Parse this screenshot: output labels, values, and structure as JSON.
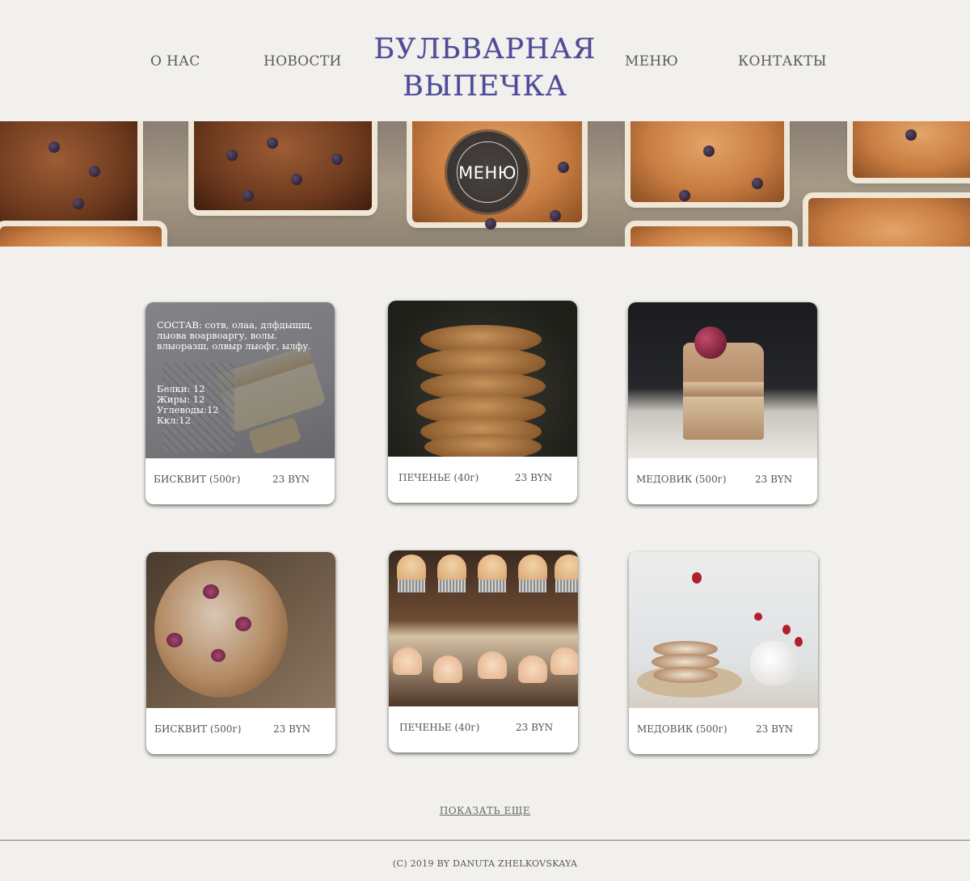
{
  "header": {
    "nav_left": [
      "О НАС",
      "НОВОСТИ"
    ],
    "nav_right": [
      "МЕНЮ",
      "КОНТАКТЫ"
    ],
    "logo_line1": "БУЛЬВАРНАЯ",
    "logo_line2": "ВЫПЕЧКА",
    "logo_color": "#4e4c97"
  },
  "banner": {
    "badge_label": "МЕНЮ"
  },
  "products": [
    {
      "name": "БИСКВИТ (500г)",
      "price": "23 BYN",
      "image_icon": "sponge-cake-image",
      "overlay": {
        "composition": "СОСТАВ: сотв, олаа, длфдыщщ, лыова воарвоаргу, волы. влыоразш, олвыр лыофг, ылфу.",
        "nutrition": [
          "Белки: 12",
          "Жиры: 12",
          "Углеводы:12",
          "Ккл:12"
        ]
      }
    },
    {
      "name": "ПЕЧЕНЬЕ (40г)",
      "price": "23 BYN",
      "image_icon": "cookie-stack-image"
    },
    {
      "name": "МЕДОВИК (500г)",
      "price": "23 BYN",
      "image_icon": "honey-cake-image"
    },
    {
      "name": "БИСКВИТ (500г)",
      "price": "23 BYN",
      "image_icon": "berry-scone-image"
    },
    {
      "name": "ПЕЧЕНЬЕ (40г)",
      "price": "23 BYN",
      "image_icon": "cupcakes-image"
    },
    {
      "name": "МЕДОВИК (500г)",
      "price": "23 BYN",
      "image_icon": "meringue-cookies-image"
    }
  ],
  "show_more_label": "ПОКАЗАТЬ ЕЩЕ",
  "footer": {
    "copyright": "(C) 2019  BY DANUTA ZHELKOVSKAYA"
  }
}
